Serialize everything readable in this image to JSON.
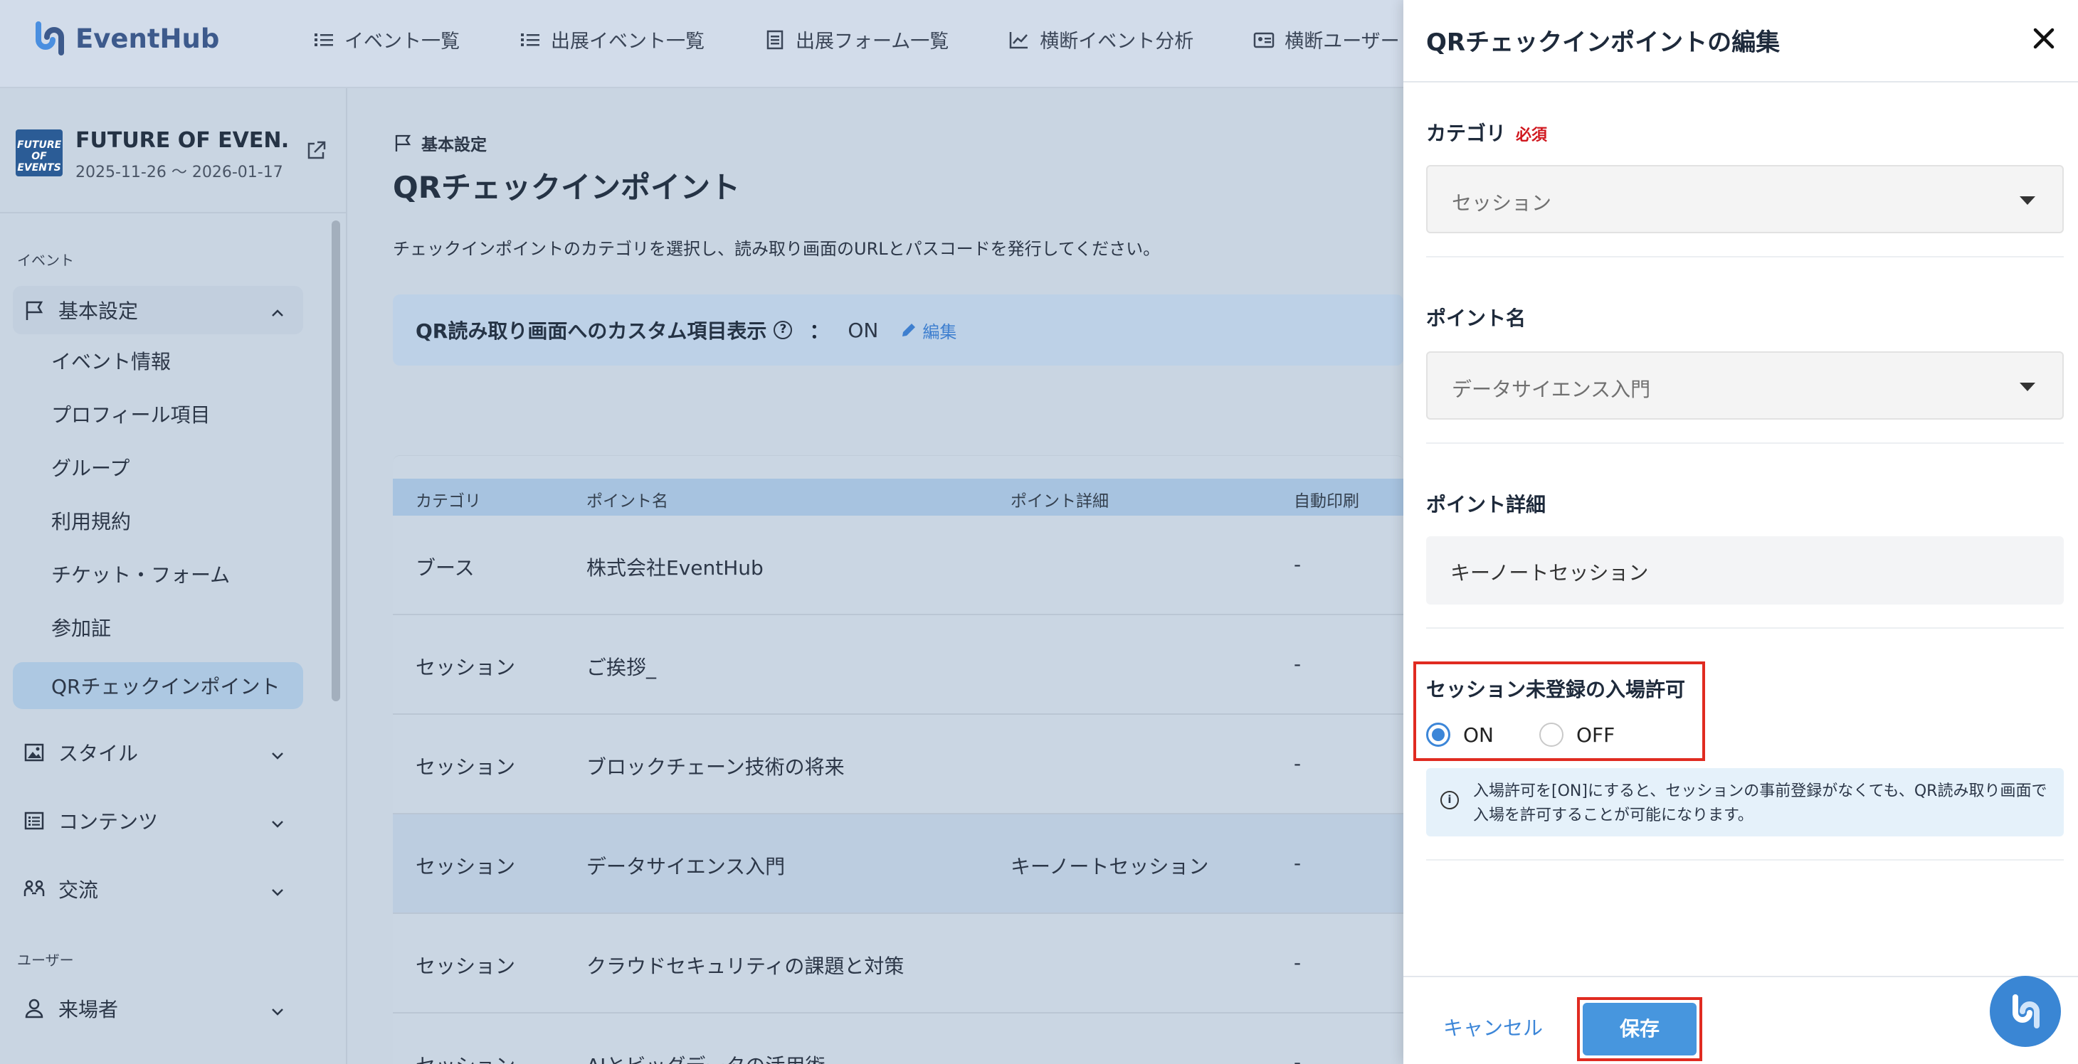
{
  "app": {
    "logo_text": "EventHub"
  },
  "topnav": [
    {
      "label": "イベント一覧",
      "icon": "list-icon"
    },
    {
      "label": "出展イベント一覧",
      "icon": "list-icon"
    },
    {
      "label": "出展フォーム一覧",
      "icon": "form-icon"
    },
    {
      "label": "横断イベント分析",
      "icon": "chart-line-icon"
    },
    {
      "label": "横断ユーザー",
      "icon": "id-card-icon"
    }
  ],
  "sidebar": {
    "event_name": "FUTURE OF EVEN…",
    "event_dates": "2025-11-26 〜 2026-01-17",
    "event_thumb_text": "FUTURE OF EVENTS",
    "section_event": "イベント",
    "section_user": "ユーザー",
    "basic_settings": "基本設定",
    "sub_items": [
      "イベント情報",
      "プロフィール項目",
      "グループ",
      "利用規約",
      "チケット・フォーム",
      "参加証",
      "QRチェックインポイント"
    ],
    "style": "スタイル",
    "contents": "コンテンツ",
    "exchange": "交流",
    "visitors": "来場者"
  },
  "main": {
    "breadcrumb": "基本設定",
    "title": "QRチェックインポイント",
    "description": "チェックインポイントのカテゴリを選択し、読み取り画面のURLとパスコードを発行してください。",
    "setting_label": "QR読み取り画面へのカスタム項目表示",
    "setting_colon": "：",
    "setting_value": "ON",
    "edit_label": "編集",
    "columns": [
      "カテゴリ",
      "ポイント名",
      "ポイント詳細",
      "自動印刷"
    ],
    "rows": [
      {
        "category": "ブース",
        "name": "株式会社EventHub",
        "detail": "",
        "auto_print": "-"
      },
      {
        "category": "セッション",
        "name": "ご挨拶_",
        "detail": "",
        "auto_print": "-"
      },
      {
        "category": "セッション",
        "name": "ブロックチェーン技術の将来",
        "detail": "",
        "auto_print": "-"
      },
      {
        "category": "セッション",
        "name": "データサイエンス入門",
        "detail": "キーノートセッション",
        "auto_print": "-"
      },
      {
        "category": "セッション",
        "name": "クラウドセキュリティの課題と対策",
        "detail": "",
        "auto_print": "-"
      },
      {
        "category": "セッション",
        "name": "AIとビッグデータの活用術",
        "detail": "",
        "auto_print": "-"
      }
    ]
  },
  "panel": {
    "title": "QRチェックインポイントの編集",
    "category_label": "カテゴリ",
    "required_label": "必須",
    "category_value": "セッション",
    "point_name_label": "ポイント名",
    "point_name_value": "データサイエンス入門",
    "point_detail_label": "ポイント詳細",
    "point_detail_value": "キーノートセッション",
    "permit_label": "セッション未登録の入場許可",
    "radio_on": "ON",
    "radio_off": "OFF",
    "selected": "ON",
    "info_text": "入場許可を[ON]にすると、セッションの事前登録がなくても、QR読み取り画面で入場を許可することが可能になります。",
    "cancel_label": "キャンセル",
    "save_label": "保存"
  },
  "colors": {
    "accent": "#3c86d8",
    "required": "#d0181f",
    "highlight": "#e02b21",
    "brand": "#3d5a8c"
  }
}
